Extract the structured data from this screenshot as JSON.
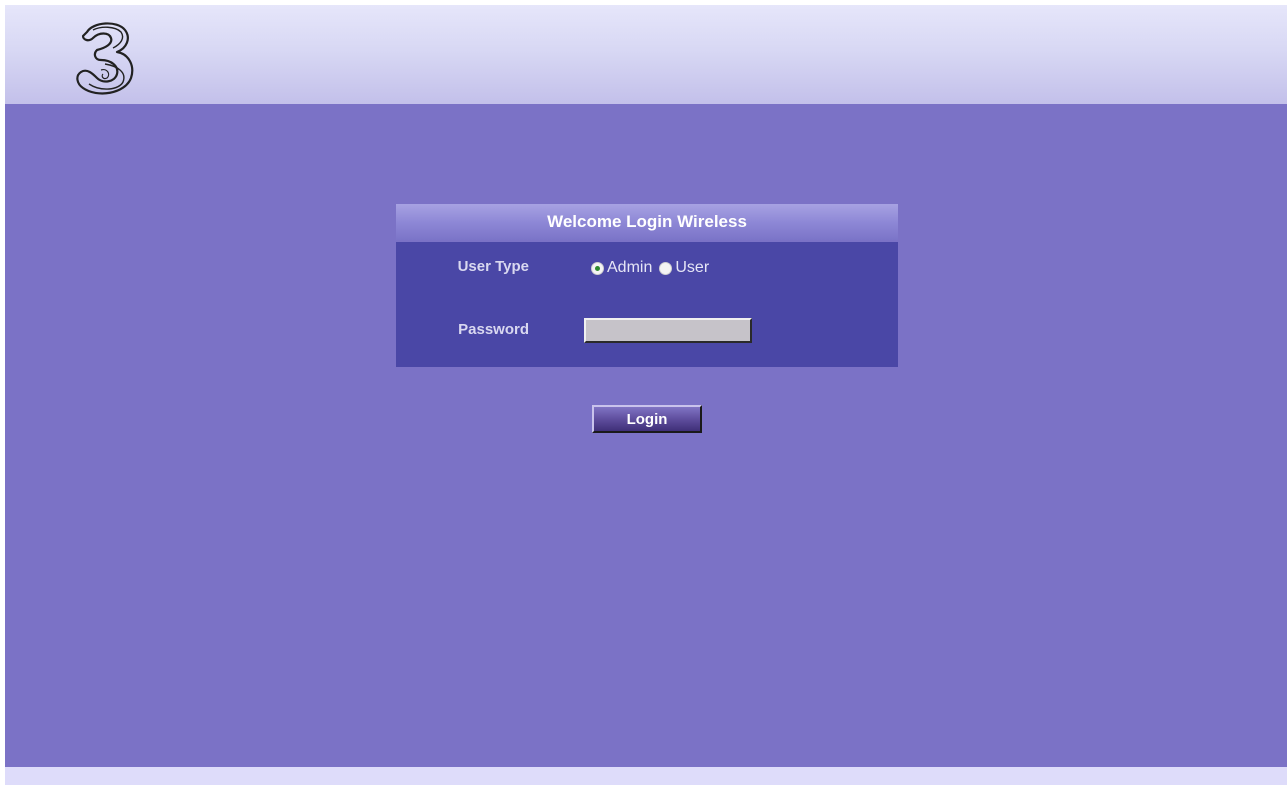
{
  "header": {
    "logo_icon": "three-logo-icon",
    "logo_text": "3"
  },
  "login": {
    "title": "Welcome Login Wireless",
    "user_type_label": "User Type",
    "user_type_options": [
      {
        "label": "Admin",
        "selected": true
      },
      {
        "label": "User",
        "selected": false
      }
    ],
    "password_label": "Password",
    "password_value": "",
    "button_label": "Login"
  },
  "colors": {
    "page_background": "#7b72c6",
    "panel_body": "#4a47a6",
    "header_gradient_top": "#e6e6fa",
    "footer": "#dedcfa",
    "radio_selected_dot": "#2f8a2f"
  }
}
